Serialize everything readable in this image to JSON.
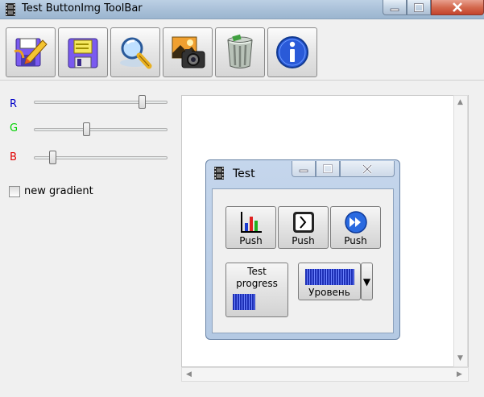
{
  "window": {
    "title": "Test ButtonImg ToolBar"
  },
  "toolbar": {
    "buttons": [
      {
        "icon": "edit-icon"
      },
      {
        "icon": "save-icon"
      },
      {
        "icon": "magnifier-icon"
      },
      {
        "icon": "camera-icon"
      },
      {
        "icon": "trash-icon"
      },
      {
        "icon": "info-icon"
      }
    ]
  },
  "sliders": {
    "r": {
      "label": "R",
      "color": "#0000c8",
      "value": 0.83
    },
    "g": {
      "label": "G",
      "color": "#00d000",
      "value": 0.39
    },
    "b": {
      "label": "B",
      "color": "#e00000",
      "value": 0.12
    }
  },
  "checkbox": {
    "label": "new gradient",
    "checked": false
  },
  "child": {
    "title": "Test",
    "push_buttons": [
      {
        "label": "Push",
        "icon": "bar-chart-icon"
      },
      {
        "label": "Push",
        "icon": "clock-icon"
      },
      {
        "label": "Push",
        "icon": "fast-forward-icon"
      }
    ],
    "progress_button": {
      "label": "Test\nprogress",
      "progress": 0.45
    },
    "level_button": {
      "label": "Уровень",
      "progress": 0.9,
      "dropdown_glyph": "▼"
    }
  }
}
